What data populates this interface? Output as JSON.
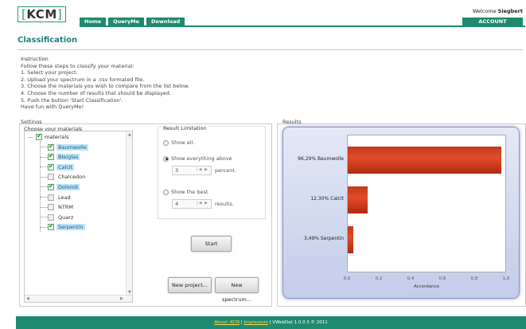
{
  "header": {
    "logo_text": "KCM",
    "nav": [
      "Home",
      "QueryMe",
      "Download"
    ],
    "welcome_prefix": "Welcome ",
    "welcome_user": "Siegbert",
    "account_label": "ACCOUNT"
  },
  "page": {
    "title": "Classification"
  },
  "instruction": {
    "heading": "Instruction",
    "lines": [
      "Follow these steps to classify your material:",
      "1. Select your project.",
      "2. Upload your spectrum in a .csv formated file.",
      "3. Choose the materials you wish to compare from the list below.",
      "4. Choose the number of results that should be displayed.",
      "5. Push the button 'Start Classification'.",
      "Have fun with QueryMe!"
    ]
  },
  "settings": {
    "heading": "Settings",
    "choose_label": "Choose your materials",
    "root_label": "materials",
    "materials": [
      {
        "label": "Baumwolle",
        "checked": true
      },
      {
        "label": "Bleiglas",
        "checked": true
      },
      {
        "label": "Calcit",
        "checked": true
      },
      {
        "label": "Chalcedon",
        "checked": false
      },
      {
        "label": "Dolomit",
        "checked": true
      },
      {
        "label": "Lead",
        "checked": false
      },
      {
        "label": "NTRM",
        "checked": false
      },
      {
        "label": "Quarz",
        "checked": false
      },
      {
        "label": "Serpentin",
        "checked": true
      }
    ],
    "limitation": {
      "heading": "Result Limitation",
      "show_all": "Show all.",
      "show_above": "Show everything above",
      "percent_value": "3",
      "percent_suffix": "percent.",
      "show_best": "Show the best",
      "best_value": "4",
      "best_suffix": "results.",
      "selected": "show_above"
    },
    "start_label": "Start",
    "new_project_label": "New project...",
    "new_spectrum_label": "New spectrum..."
  },
  "results": {
    "heading": "Results"
  },
  "chart_data": {
    "type": "bar",
    "orientation": "horizontal",
    "categories": [
      "96,29% Baumwolle",
      "12,30% Calcit",
      "3,49% Serpentin"
    ],
    "values": [
      0.9629,
      0.123,
      0.0349
    ],
    "xlabel": "Accordance",
    "xlim": [
      0,
      1
    ],
    "xticks": [
      "0,0",
      "0,2",
      "0,4",
      "0,6",
      "0,8",
      "1,0"
    ],
    "bar_color": "#d23a1c"
  },
  "footer": {
    "about": "About: KCM",
    "sep1": " | ",
    "impressum": "Impressum",
    "rest": " | VWebDat 1.0.0.3 © 2011"
  }
}
